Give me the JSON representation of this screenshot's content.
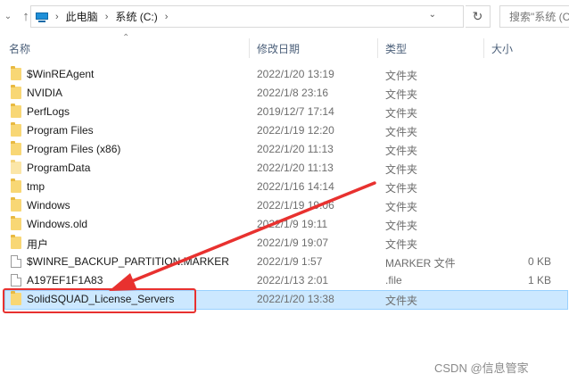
{
  "address": {
    "breadcrumbs": [
      "此电脑",
      "系统 (C:)"
    ],
    "search_placeholder": "搜索\"系统 (C:)\""
  },
  "columns": {
    "name": "名称",
    "date": "修改日期",
    "type": "类型",
    "size": "大小"
  },
  "rows": [
    {
      "name": "$WinREAgent",
      "date": "2022/1/20 13:19",
      "type": "文件夹",
      "size": "",
      "icon": "folder-icon"
    },
    {
      "name": "NVIDIA",
      "date": "2022/1/8 23:16",
      "type": "文件夹",
      "size": "",
      "icon": "folder-icon"
    },
    {
      "name": "PerfLogs",
      "date": "2019/12/7 17:14",
      "type": "文件夹",
      "size": "",
      "icon": "folder-icon"
    },
    {
      "name": "Program Files",
      "date": "2022/1/19 12:20",
      "type": "文件夹",
      "size": "",
      "icon": "folder-icon"
    },
    {
      "name": "Program Files (x86)",
      "date": "2022/1/20 11:13",
      "type": "文件夹",
      "size": "",
      "icon": "folder-icon"
    },
    {
      "name": "ProgramData",
      "date": "2022/1/20 11:13",
      "type": "文件夹",
      "size": "",
      "icon": "folder-hidden-icon"
    },
    {
      "name": "tmp",
      "date": "2022/1/16 14:14",
      "type": "文件夹",
      "size": "",
      "icon": "folder-icon"
    },
    {
      "name": "Windows",
      "date": "2022/1/19 19:06",
      "type": "文件夹",
      "size": "",
      "icon": "folder-icon"
    },
    {
      "name": "Windows.old",
      "date": "2022/1/9 19:11",
      "type": "文件夹",
      "size": "",
      "icon": "folder-icon"
    },
    {
      "name": "用户",
      "date": "2022/1/9 19:07",
      "type": "文件夹",
      "size": "",
      "icon": "folder-icon"
    },
    {
      "name": "$WINRE_BACKUP_PARTITION.MARKER",
      "date": "2022/1/9 1:57",
      "type": "MARKER 文件",
      "size": "0 KB",
      "icon": "file-icon"
    },
    {
      "name": "A197EF1F1A83",
      "date": "2022/1/13 2:01",
      "type": ".file",
      "size": "1 KB",
      "icon": "file-icon"
    },
    {
      "name": "SolidSQUAD_License_Servers",
      "date": "2022/1/20 13:38",
      "type": "文件夹",
      "size": "",
      "icon": "folder-icon",
      "selected": true
    }
  ],
  "colors": {
    "selection_bg": "#cce8ff",
    "selection_border": "#99d1ff",
    "annotation_red": "#e8312f",
    "header_text": "#4c607a"
  },
  "watermark": "CSDN @信息管家"
}
